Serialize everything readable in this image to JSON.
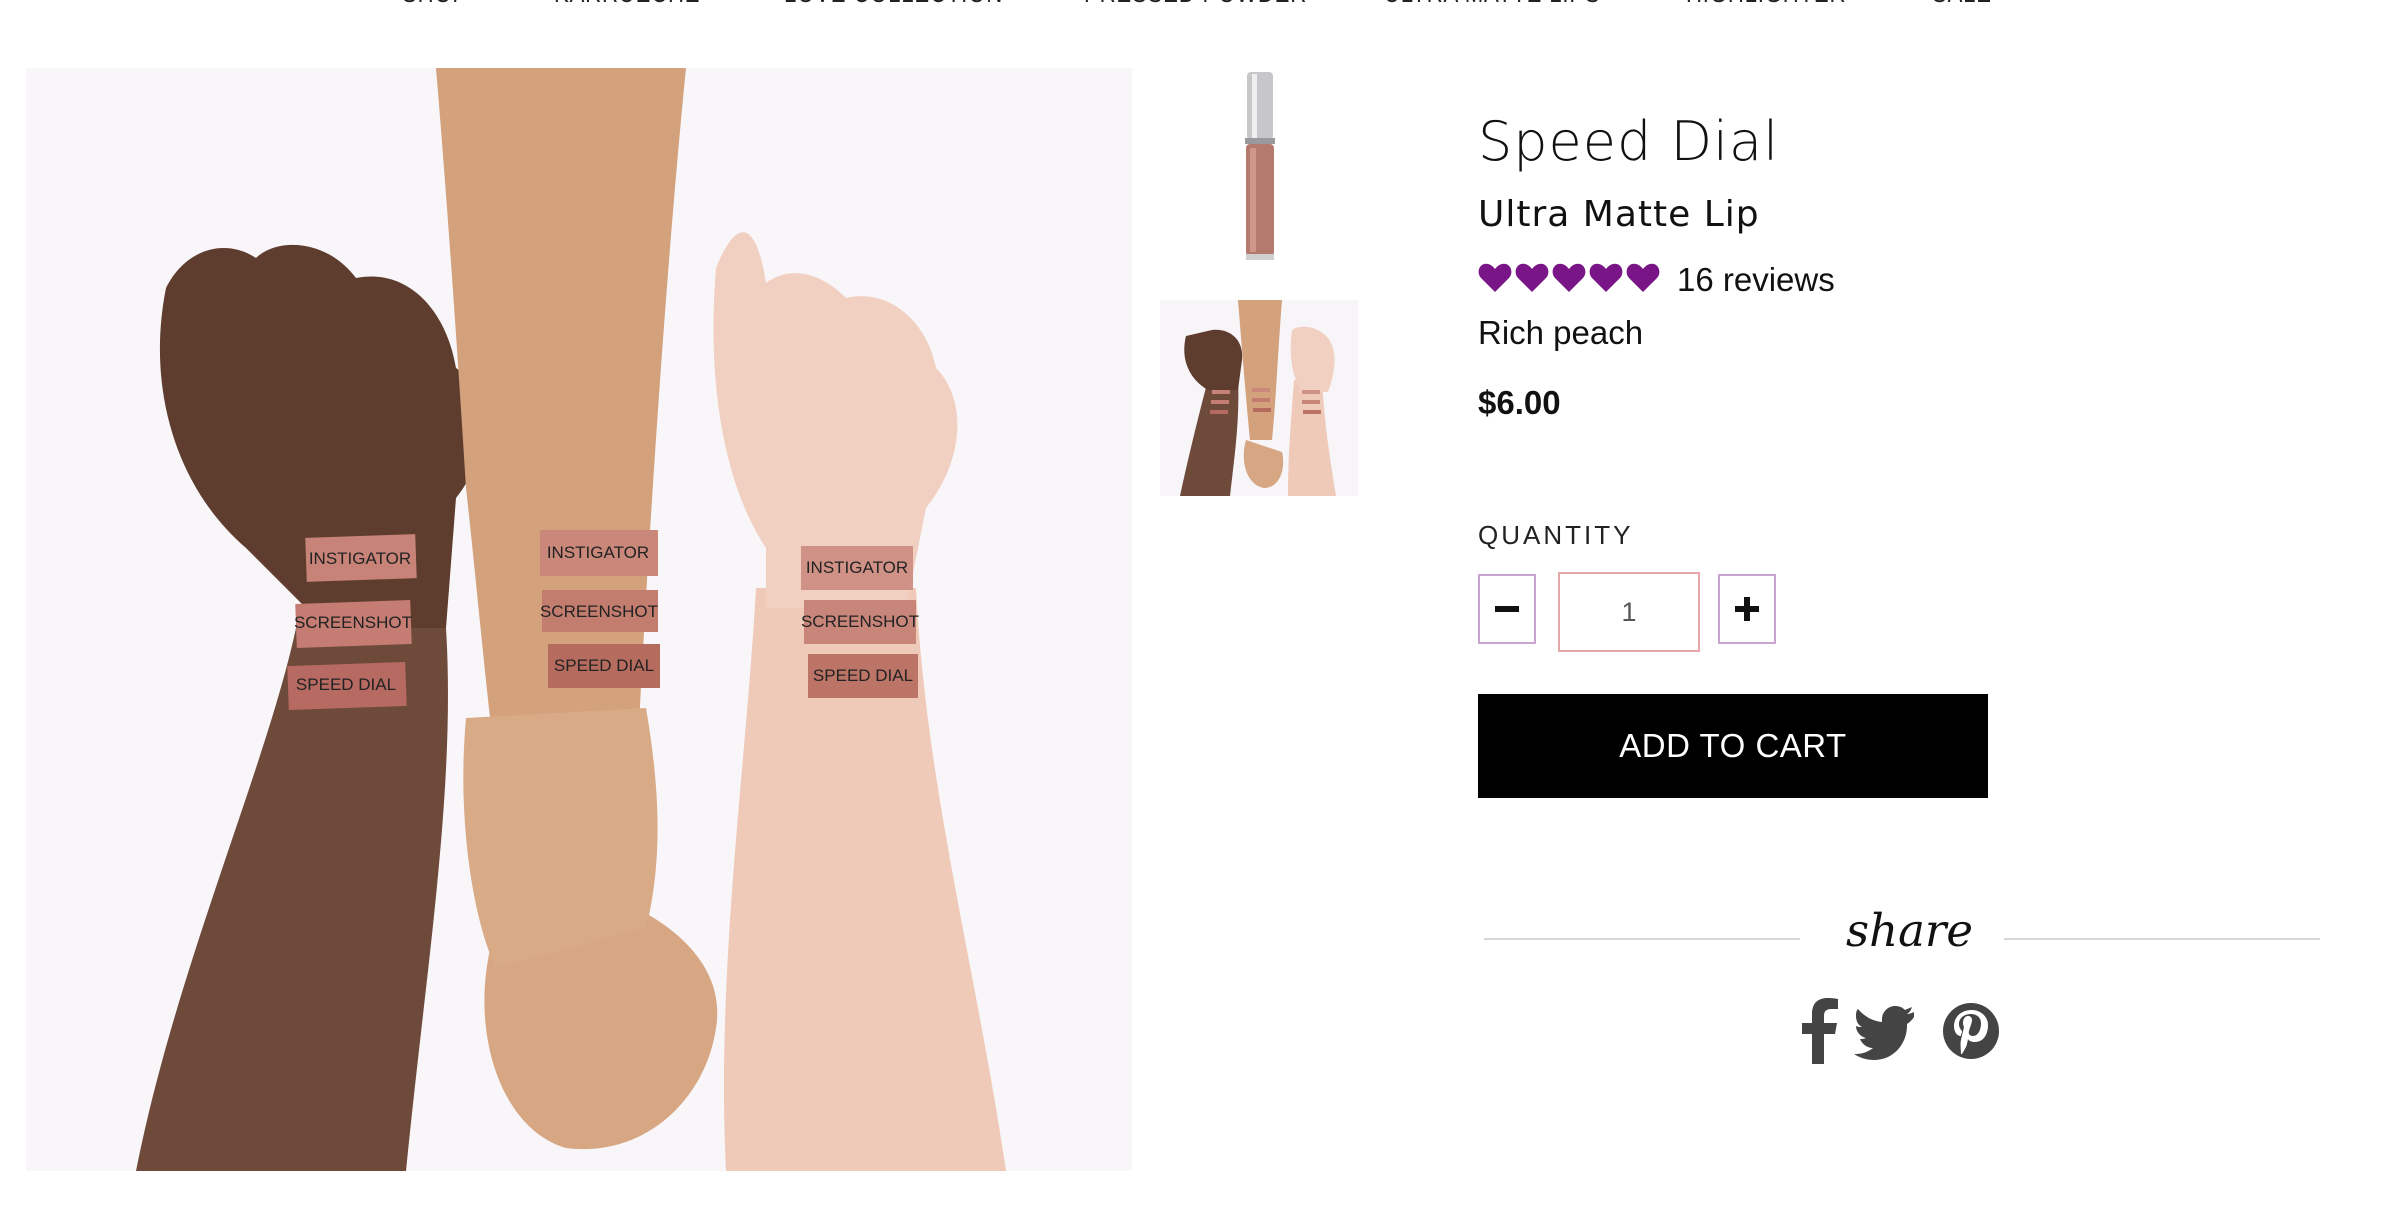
{
  "nav": {
    "items": [
      "SHOP",
      "KARRUECHE",
      "LOVE COLLECTION",
      "PRESSED POWDER",
      "ULTRA MATTE LIPS",
      "HIGHLIGHTER",
      "SALE"
    ]
  },
  "swatches": {
    "labels": [
      "INSTIGATOR",
      "SCREENSHOT",
      "SPEED DIAL"
    ]
  },
  "product": {
    "title": "Speed Dial",
    "subtitle": "Ultra Matte Lip",
    "rating": 5,
    "reviews_text": "16 reviews",
    "shade_description": "Rich peach",
    "price": "$6.00"
  },
  "quantity": {
    "label": "QUANTITY",
    "value": "1"
  },
  "cart": {
    "add_label": "ADD TO CART"
  },
  "share": {
    "label": "share",
    "icons": [
      "facebook-icon",
      "twitter-icon",
      "pinterest-icon"
    ]
  },
  "colors": {
    "heart": "#7a1588",
    "button_bg": "#000000",
    "qty_border": "#c9a6cf",
    "input_border": "#e2a7aa",
    "icon": "#444444"
  }
}
